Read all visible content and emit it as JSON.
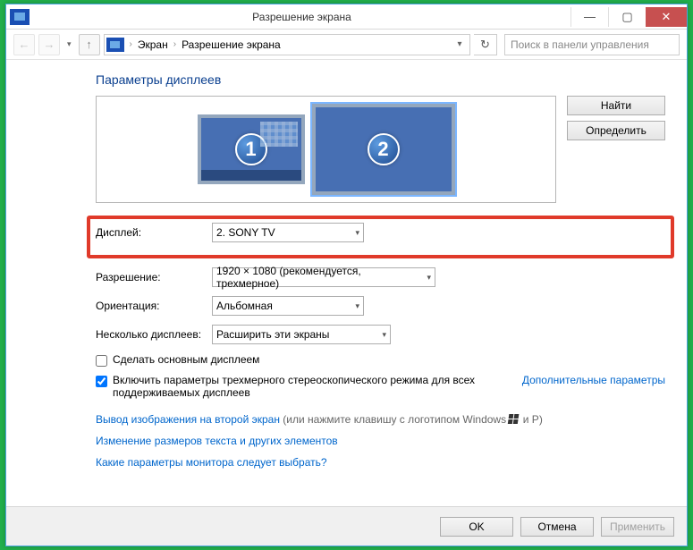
{
  "window": {
    "title": "Разрешение экрана"
  },
  "titlebar_ctrls": {
    "min": "—",
    "max": "▢",
    "close": "✕"
  },
  "breadcrumb": {
    "item1": "Экран",
    "item2": "Разрешение экрана"
  },
  "search": {
    "placeholder": "Поиск в панели управления"
  },
  "heading": "Параметры дисплеев",
  "monitors": {
    "m1": "1",
    "m2": "2"
  },
  "sidebuttons": {
    "find": "Найти",
    "identify": "Определить"
  },
  "form": {
    "display_label": "Дисплей:",
    "display_value": "2. SONY TV",
    "resolution_label": "Разрешение:",
    "resolution_value": "1920 × 1080 (рекомендуется, трехмерное)",
    "orientation_label": "Ориентация:",
    "orientation_value": "Альбомная",
    "multiple_label": "Несколько дисплеев:",
    "multiple_value": "Расширить эти экраны"
  },
  "checks": {
    "make_main": "Сделать основным дисплеем",
    "stereo": "Включить параметры трехмерного стереоскопического режима для всех поддерживаемых дисплеев"
  },
  "links": {
    "advanced": "Дополнительные параметры",
    "projector": "Вывод изображения на второй экран",
    "projector_tail": " (или нажмите клавишу с логотипом Windows ",
    "projector_tail2": " и P)",
    "textsize": "Изменение размеров текста и других элементов",
    "which": "Какие параметры монитора следует выбрать?"
  },
  "footer": {
    "ok": "OK",
    "cancel": "Отмена",
    "apply": "Применить"
  }
}
